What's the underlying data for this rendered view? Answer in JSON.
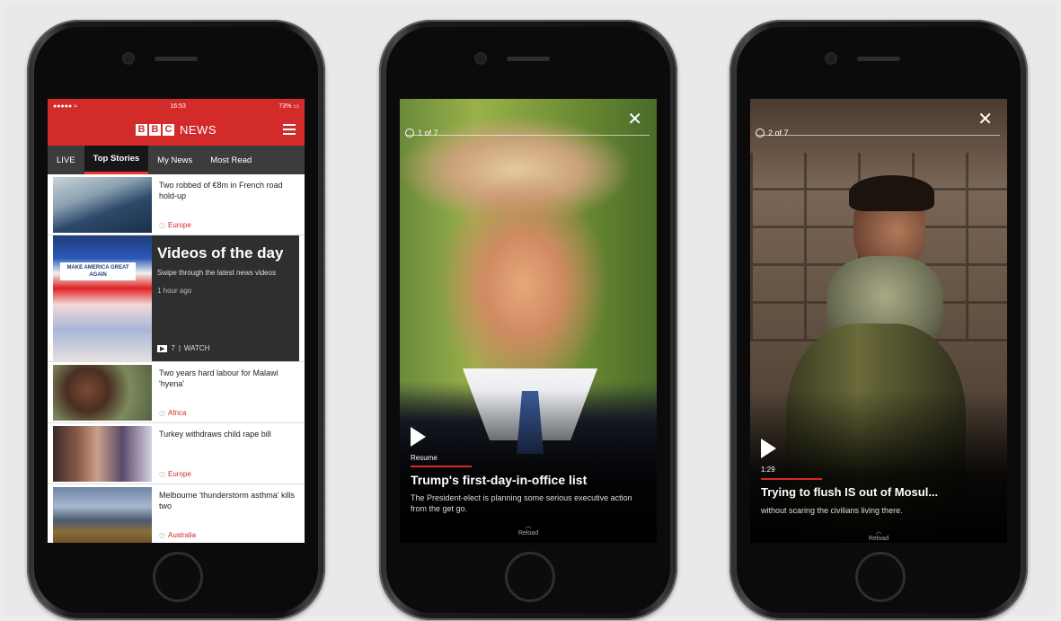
{
  "phone1": {
    "status": {
      "left": "●●●●● ≈",
      "time": "16:53",
      "right": "73% ▭"
    },
    "brand": {
      "b1": "B",
      "b2": "B",
      "b3": "C",
      "name": "NEWS"
    },
    "tabs": [
      {
        "label": "LIVE"
      },
      {
        "label": "Top Stories"
      },
      {
        "label": "My News"
      },
      {
        "label": "Most Read"
      }
    ],
    "stories": [
      {
        "headline": "Two robbed of €8m in French road hold-up",
        "section": "Europe"
      },
      {
        "headline": "Two years hard labour for Malawi 'hyena'",
        "section": "Africa"
      },
      {
        "headline": "Turkey withdraws child rape bill",
        "section": "Europe"
      },
      {
        "headline": "Melbourne 'thunderstorm asthma' kills two",
        "section": "Australia"
      }
    ],
    "video_card": {
      "title": "Videos of the day",
      "description": "Swipe through the latest news videos",
      "time": "1 hour ago",
      "count": "7",
      "watch": "WATCH",
      "thumb_sign": "MAKE AMERICA GREAT AGAIN"
    }
  },
  "phone2": {
    "counter": "1 of 7",
    "play_label": "Resume",
    "headline": "Trump's first-day-in-office list",
    "description": "The President-elect is planning some serious executive action from the get go.",
    "reload": "Reload",
    "close": "✕"
  },
  "phone3": {
    "counter": "2 of 7",
    "duration": "1:29",
    "headline": "Trying to flush IS out of Mosul...",
    "description": "without scaring the civilians living there.",
    "reload": "Reload",
    "close": "✕"
  }
}
